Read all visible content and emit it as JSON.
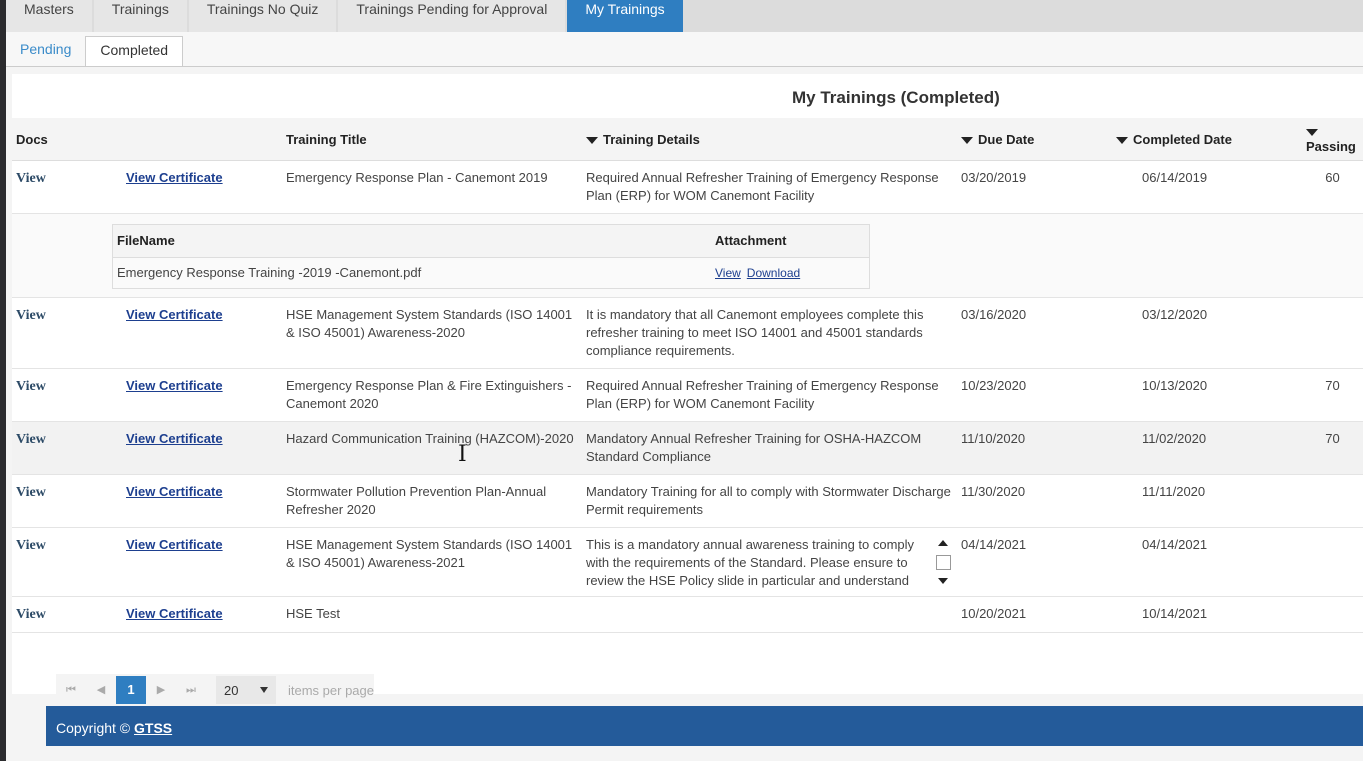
{
  "topnav": {
    "tabs": [
      "Masters",
      "Trainings",
      "Trainings No Quiz",
      "Trainings Pending for Approval",
      "My Trainings"
    ]
  },
  "subtabs": [
    "Pending",
    "Completed"
  ],
  "grid": {
    "title": "My Trainings (Completed)",
    "headers": {
      "docs": "Docs",
      "title": "Training Title",
      "details": "Training Details",
      "due": "Due Date",
      "completed": "Completed Date",
      "passing": "Passing"
    },
    "rows": [
      {
        "view": "View",
        "cert": "View Certificate",
        "title": "Emergency Response Plan - Canemont 2019",
        "details": "Required Annual Refresher Training of Emergency Response Plan (ERP) for WOM Canemont Facility",
        "due": "03/20/2019",
        "completed": "06/14/2019",
        "passing": "60"
      },
      {
        "view": "View",
        "cert": "View Certificate",
        "title": "HSE Management System Standards (ISO 14001 & ISO 45001) Awareness-2020",
        "details": "It is mandatory that all Canemont employees complete this refresher training to meet ISO 14001 and 45001 standards compliance requirements.",
        "due": "03/16/2020",
        "completed": "03/12/2020",
        "passing": ""
      },
      {
        "view": "View",
        "cert": "View Certificate",
        "title": "Emergency Response Plan & Fire Extinguishers - Canemont 2020",
        "details": "Required Annual Refresher Training of Emergency Response Plan (ERP) for WOM Canemont Facility",
        "due": "10/23/2020",
        "completed": "10/13/2020",
        "passing": "70"
      },
      {
        "view": "View",
        "cert": "View Certificate",
        "title": "Hazard Communication Training (HAZCOM)-2020",
        "details": "Mandatory Annual Refresher Training for OSHA-HAZCOM Standard Compliance",
        "due": "11/10/2020",
        "completed": "11/02/2020",
        "passing": "70"
      },
      {
        "view": "View",
        "cert": "View Certificate",
        "title": "Stormwater Pollution Prevention Plan-Annual Refresher 2020",
        "details": "Mandatory Training for all to comply with Stormwater Discharge Permit requirements",
        "due": "11/30/2020",
        "completed": "11/11/2020",
        "passing": ""
      },
      {
        "view": "View",
        "cert": "View Certificate",
        "title": "HSE Management System Standards (ISO 14001 & ISO 45001) Awareness-2021",
        "details": "This is a mandatory annual awareness training to comply with the requirements of the Standard. Please ensure to review the HSE Policy slide in particular and understand",
        "due": "04/14/2021",
        "completed": "04/14/2021",
        "passing": ""
      },
      {
        "view": "View",
        "cert": "View Certificate",
        "title": "HSE Test",
        "details": "",
        "due": "10/20/2021",
        "completed": "10/14/2021",
        "passing": ""
      }
    ],
    "detail": {
      "headers": {
        "filename": "FileName",
        "attachment": "Attachment"
      },
      "file": "Emergency Response Training -2019 -Canemont.pdf",
      "view": "View",
      "download": "Download"
    }
  },
  "pager": {
    "page": "1",
    "per_page": "20",
    "label": "items per page"
  },
  "footer": {
    "text": "Copyright © ",
    "link": "GTSS"
  }
}
